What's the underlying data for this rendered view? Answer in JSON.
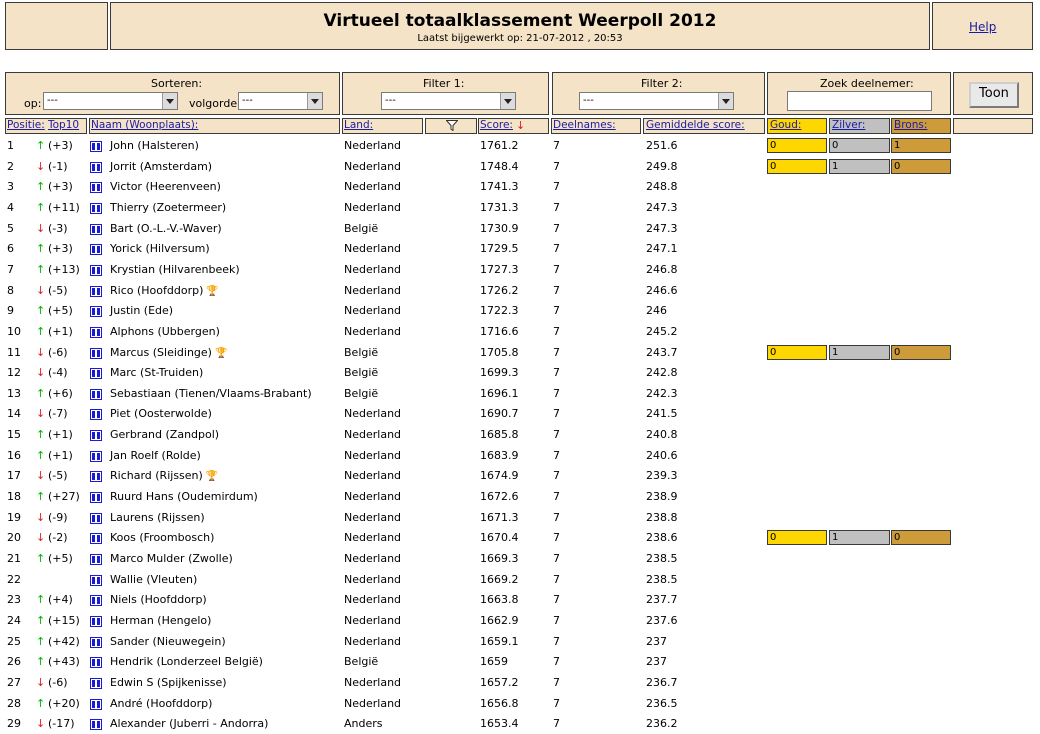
{
  "header": {
    "title": "Virtueel totaalklassement Weerpoll 2012",
    "subtitle": "Laatst bijgewerkt op: 21-07-2012 , 20:53",
    "help": "Help"
  },
  "controls": {
    "sort_label": "Sorteren:",
    "op_label": "op:",
    "op_value": "---",
    "order_label": "volgorde:",
    "order_value": "---",
    "filter1_label": "Filter 1:",
    "filter1_value": "---",
    "filter2_label": "Filter 2:",
    "filter2_value": "---",
    "search_label": "Zoek deelnemer:",
    "search_value": "",
    "show_button": "Toon"
  },
  "columns": {
    "position": "Positie:",
    "top10": "Top10",
    "name": "Naam (Woonplaats):",
    "country": "Land:",
    "score": "Score:",
    "participations": "Deelnames:",
    "avg": "Gemiddelde score:",
    "gold": "Goud:",
    "silver": "Zilver:",
    "bronze": "Brons:"
  },
  "colors": {
    "panel": "#f5e3c7",
    "gold": "#ffd700",
    "silver": "#c0c0c0",
    "bronze": "#cd9b3a",
    "up": "#00b200",
    "down": "#d42222",
    "link": "#1a1aa6"
  },
  "rows": [
    {
      "pos": "1",
      "dir": "up",
      "change": "(+3)",
      "name": "John (Halsteren)",
      "trophy": false,
      "country": "Nederland",
      "score": "1761.2",
      "part": "7",
      "avg": "251.6",
      "medals": [
        "0",
        "0",
        "1"
      ]
    },
    {
      "pos": "2",
      "dir": "down",
      "change": "(-1)",
      "name": "Jorrit (Amsterdam)",
      "trophy": false,
      "country": "Nederland",
      "score": "1748.4",
      "part": "7",
      "avg": "249.8",
      "medals": [
        "0",
        "1",
        "0"
      ]
    },
    {
      "pos": "3",
      "dir": "up",
      "change": "(+3)",
      "name": "Victor (Heerenveen)",
      "trophy": false,
      "country": "Nederland",
      "score": "1741.3",
      "part": "7",
      "avg": "248.8",
      "medals": null
    },
    {
      "pos": "4",
      "dir": "up",
      "change": "(+11)",
      "name": "Thierry (Zoetermeer)",
      "trophy": false,
      "country": "Nederland",
      "score": "1731.3",
      "part": "7",
      "avg": "247.3",
      "medals": null
    },
    {
      "pos": "5",
      "dir": "down",
      "change": "(-3)",
      "name": "Bart (O.-L.-V.-Waver)",
      "trophy": false,
      "country": "België",
      "score": "1730.9",
      "part": "7",
      "avg": "247.3",
      "medals": null
    },
    {
      "pos": "6",
      "dir": "up",
      "change": "(+3)",
      "name": "Yorick (Hilversum)",
      "trophy": false,
      "country": "Nederland",
      "score": "1729.5",
      "part": "7",
      "avg": "247.1",
      "medals": null
    },
    {
      "pos": "7",
      "dir": "up",
      "change": "(+13)",
      "name": "Krystian (Hilvarenbeek)",
      "trophy": false,
      "country": "Nederland",
      "score": "1727.3",
      "part": "7",
      "avg": "246.8",
      "medals": null
    },
    {
      "pos": "8",
      "dir": "down",
      "change": "(-5)",
      "name": "Rico (Hoofddorp)",
      "trophy": true,
      "country": "Nederland",
      "score": "1726.2",
      "part": "7",
      "avg": "246.6",
      "medals": null
    },
    {
      "pos": "9",
      "dir": "up",
      "change": "(+5)",
      "name": "Justin (Ede)",
      "trophy": false,
      "country": "Nederland",
      "score": "1722.3",
      "part": "7",
      "avg": "246",
      "medals": null
    },
    {
      "pos": "10",
      "dir": "up",
      "change": "(+1)",
      "name": "Alphons (Ubbergen)",
      "trophy": false,
      "country": "Nederland",
      "score": "1716.6",
      "part": "7",
      "avg": "245.2",
      "medals": null
    },
    {
      "pos": "11",
      "dir": "down",
      "change": "(-6)",
      "name": "Marcus (Sleidinge)",
      "trophy": true,
      "country": "België",
      "score": "1705.8",
      "part": "7",
      "avg": "243.7",
      "medals": [
        "0",
        "1",
        "0"
      ]
    },
    {
      "pos": "12",
      "dir": "down",
      "change": "(-4)",
      "name": "Marc (St-Truiden)",
      "trophy": false,
      "country": "België",
      "score": "1699.3",
      "part": "7",
      "avg": "242.8",
      "medals": null
    },
    {
      "pos": "13",
      "dir": "up",
      "change": "(+6)",
      "name": "Sebastiaan (Tienen/Vlaams-Brabant)",
      "trophy": false,
      "country": "België",
      "score": "1696.1",
      "part": "7",
      "avg": "242.3",
      "medals": null
    },
    {
      "pos": "14",
      "dir": "down",
      "change": "(-7)",
      "name": "Piet (Oosterwolde)",
      "trophy": false,
      "country": "Nederland",
      "score": "1690.7",
      "part": "7",
      "avg": "241.5",
      "medals": null
    },
    {
      "pos": "15",
      "dir": "up",
      "change": "(+1)",
      "name": "Gerbrand (Zandpol)",
      "trophy": false,
      "country": "Nederland",
      "score": "1685.8",
      "part": "7",
      "avg": "240.8",
      "medals": null
    },
    {
      "pos": "16",
      "dir": "up",
      "change": "(+1)",
      "name": "Jan Roelf (Rolde)",
      "trophy": false,
      "country": "Nederland",
      "score": "1683.9",
      "part": "7",
      "avg": "240.6",
      "medals": null
    },
    {
      "pos": "17",
      "dir": "down",
      "change": "(-5)",
      "name": "Richard (Rijssen)",
      "trophy": true,
      "country": "Nederland",
      "score": "1674.9",
      "part": "7",
      "avg": "239.3",
      "medals": null
    },
    {
      "pos": "18",
      "dir": "up",
      "change": "(+27)",
      "name": "Ruurd Hans (Oudemirdum)",
      "trophy": false,
      "country": "Nederland",
      "score": "1672.6",
      "part": "7",
      "avg": "238.9",
      "medals": null
    },
    {
      "pos": "19",
      "dir": "down",
      "change": "(-9)",
      "name": "Laurens (Rijssen)",
      "trophy": false,
      "country": "Nederland",
      "score": "1671.3",
      "part": "7",
      "avg": "238.8",
      "medals": null
    },
    {
      "pos": "20",
      "dir": "down",
      "change": "(-2)",
      "name": "Koos (Froombosch)",
      "trophy": false,
      "country": "Nederland",
      "score": "1670.4",
      "part": "7",
      "avg": "238.6",
      "medals": [
        "0",
        "1",
        "0"
      ]
    },
    {
      "pos": "21",
      "dir": "up",
      "change": "(+5)",
      "name": "Marco Mulder (Zwolle)",
      "trophy": false,
      "country": "Nederland",
      "score": "1669.3",
      "part": "7",
      "avg": "238.5",
      "medals": null
    },
    {
      "pos": "22",
      "dir": "none",
      "change": "",
      "name": "Wallie (Vleuten)",
      "trophy": false,
      "country": "Nederland",
      "score": "1669.2",
      "part": "7",
      "avg": "238.5",
      "medals": null
    },
    {
      "pos": "23",
      "dir": "up",
      "change": "(+4)",
      "name": "Niels (Hoofddorp)",
      "trophy": false,
      "country": "Nederland",
      "score": "1663.8",
      "part": "7",
      "avg": "237.7",
      "medals": null
    },
    {
      "pos": "24",
      "dir": "up",
      "change": "(+15)",
      "name": "Herman (Hengelo)",
      "trophy": false,
      "country": "Nederland",
      "score": "1662.9",
      "part": "7",
      "avg": "237.6",
      "medals": null
    },
    {
      "pos": "25",
      "dir": "up",
      "change": "(+42)",
      "name": "Sander (Nieuwegein)",
      "trophy": false,
      "country": "Nederland",
      "score": "1659.1",
      "part": "7",
      "avg": "237",
      "medals": null
    },
    {
      "pos": "26",
      "dir": "up",
      "change": "(+43)",
      "name": "Hendrik (Londerzeel België)",
      "trophy": false,
      "country": "België",
      "score": "1659",
      "part": "7",
      "avg": "237",
      "medals": null
    },
    {
      "pos": "27",
      "dir": "down",
      "change": "(-6)",
      "name": "Edwin S (Spijkenisse)",
      "trophy": false,
      "country": "Nederland",
      "score": "1657.2",
      "part": "7",
      "avg": "236.7",
      "medals": null
    },
    {
      "pos": "28",
      "dir": "up",
      "change": "(+20)",
      "name": "André (Hoofddorp)",
      "trophy": false,
      "country": "Nederland",
      "score": "1656.8",
      "part": "7",
      "avg": "236.5",
      "medals": null
    },
    {
      "pos": "29",
      "dir": "down",
      "change": "(-17)",
      "name": "Alexander (Juberri - Andorra)",
      "trophy": false,
      "country": "Anders",
      "score": "1653.4",
      "part": "7",
      "avg": "236.2",
      "medals": null
    }
  ]
}
